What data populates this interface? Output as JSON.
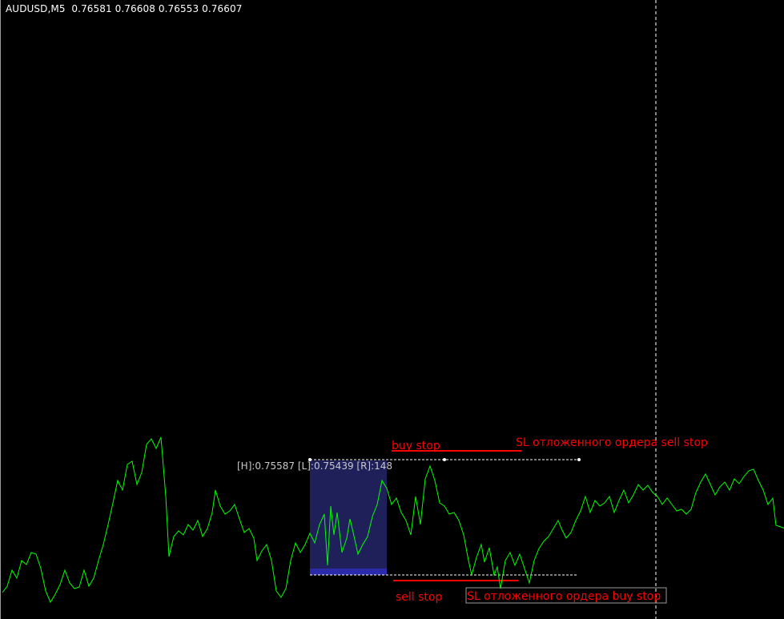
{
  "header": {
    "symbol_timeframe": "AUDUSD,M5",
    "ohlc": "0.76581 0.76608 0.76553 0.76607"
  },
  "range_box": {
    "high_low_range_label": "[H]:0.75587 [L]:0.75439 [R]:148"
  },
  "annotations": {
    "buy_stop": "buy stop",
    "sell_stop": "sell stop",
    "sl_sell_stop": "SL отложенного ордера sell stop",
    "sl_buy_stop": "SL отложенного ордера buy stop"
  },
  "colors": {
    "background": "#000000",
    "price_line": "#00ff00",
    "annotation": "#ff0000",
    "range_box_fill": "#1f1f5a",
    "range_box_bottom": "#2b2baa",
    "dotted_level": "#ffffff",
    "header_text": "#ffffff",
    "range_label": "#c8c8c8"
  },
  "chart_data": {
    "type": "line",
    "symbol": "AUDUSD",
    "timeframe": "M5",
    "range_high": 0.75587,
    "range_low": 0.75439,
    "range_points": 148,
    "grid": false
  }
}
